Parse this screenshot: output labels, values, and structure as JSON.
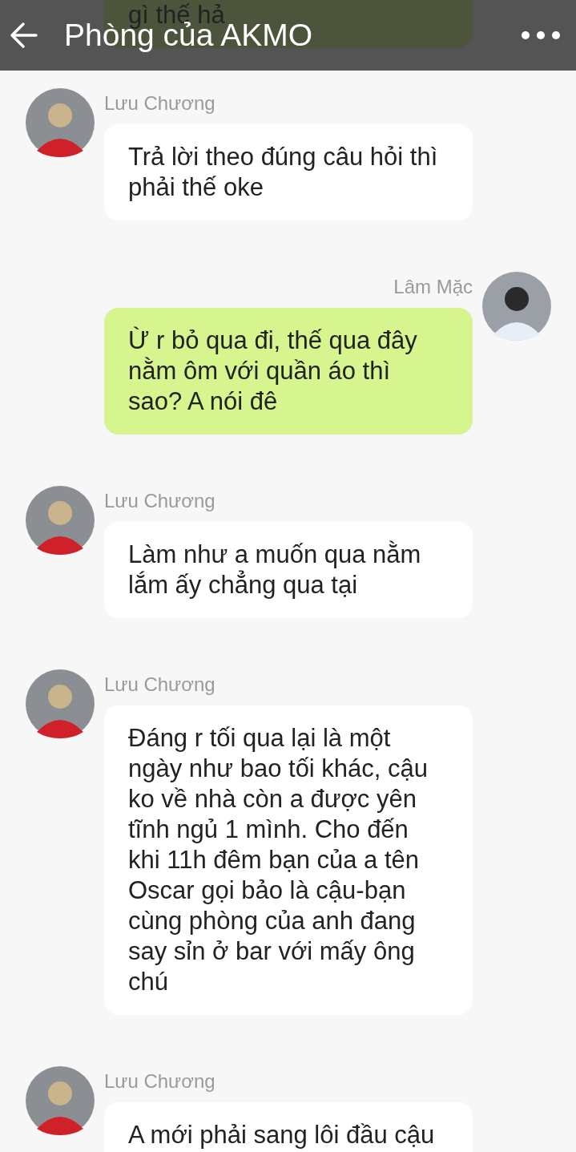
{
  "header": {
    "title": "Phòng của AKMO"
  },
  "messages": [
    {
      "kind": "outgoing",
      "text": "gì thế hả"
    },
    {
      "kind": "incoming",
      "sender": "Lưu Chương",
      "text": "Trả lời theo đúng câu hỏi thì phải thế oke"
    },
    {
      "kind": "outgoing",
      "sender": "Lâm Mặc",
      "text": "Ừ r bỏ qua đi, thế qua đây nằm ôm với quần áo thì sao? A nói đê"
    },
    {
      "kind": "incoming",
      "sender": "Lưu Chương",
      "text": "Làm như a muốn qua nằm lắm ấy chẳng qua tại"
    },
    {
      "kind": "incoming",
      "sender": "Lưu Chương",
      "text": "Đáng r tối qua lại là một ngày như bao tối khác, cậu ko về nhà còn a được yên tĩnh ngủ 1 mình. Cho đến khi 11h đêm bạn của a tên Oscar gọi bảo là cậu-bạn cùng phòng của anh đang say sỉn ở bar với mấy ông chú"
    },
    {
      "kind": "incoming",
      "sender": "Lưu Chương",
      "text": "A mới phải sang lôi đầu cậu"
    }
  ]
}
